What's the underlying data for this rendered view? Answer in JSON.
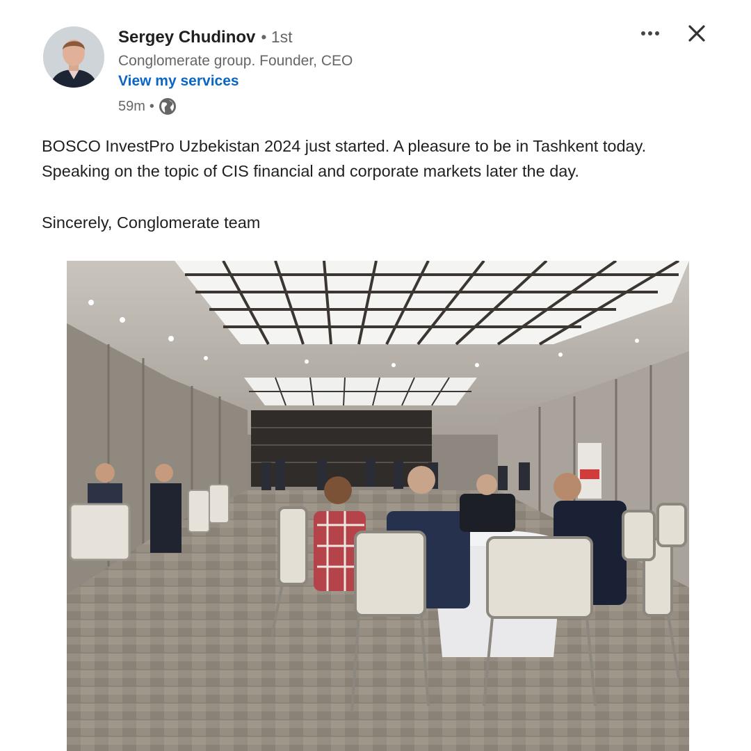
{
  "author": {
    "name": "Sergey Chudinov",
    "degree": "• 1st",
    "headline": "Conglomerate group. Founder, CEO",
    "services_link": "View my services"
  },
  "post_meta": {
    "time": "59m",
    "separator": "•",
    "visibility_icon": "globe-icon"
  },
  "actions": {
    "more_icon": "more-options-icon",
    "close_icon": "close-icon"
  },
  "post_text": {
    "line1": "BOSCO InvestPro Uzbekistan 2024 just started. A pleasure to be in Tashkent today.",
    "line2": "Speaking on the topic of CIS financial and corporate markets later the day.",
    "signoff": "Sincerely, Conglomerate team"
  },
  "colors": {
    "link": "#0a66c2",
    "secondary_text": "#666666",
    "primary_text": "#1f1f1f"
  }
}
